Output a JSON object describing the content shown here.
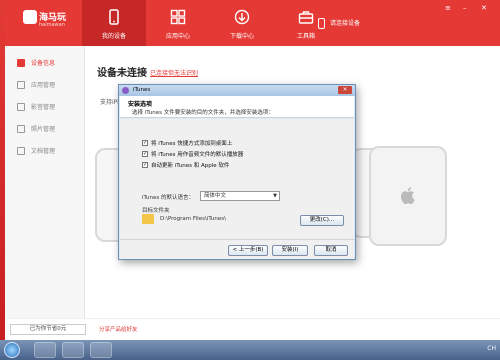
{
  "app": {
    "logo_name": "海马玩",
    "logo_sub": "haimawan",
    "nav": [
      {
        "label": "我的设备",
        "icon": "phone-icon",
        "active": true
      },
      {
        "label": "应用中心",
        "icon": "apps-grid-icon",
        "active": false
      },
      {
        "label": "下载中心",
        "icon": "download-icon",
        "active": false
      },
      {
        "label": "工具箱",
        "icon": "toolbox-icon",
        "active": false
      }
    ],
    "connect_label": "请连接设备"
  },
  "sidebar": {
    "items": [
      {
        "label": "设备信息",
        "icon": "device-info-icon",
        "active": true
      },
      {
        "label": "应用管理",
        "icon": "app-manage-icon",
        "active": false
      },
      {
        "label": "影音管理",
        "icon": "music-icon",
        "active": false
      },
      {
        "label": "照片管理",
        "icon": "photo-icon",
        "active": false
      },
      {
        "label": "文档管理",
        "icon": "document-icon",
        "active": false
      }
    ]
  },
  "main": {
    "title": "设备未连接",
    "link": "已连接但无法识别",
    "sub": "支持iPhon"
  },
  "status": {
    "storage": "已为你节省0元",
    "share": "分享产品给好友"
  },
  "dialog": {
    "window_title": "iTunes",
    "heading": "安装选项",
    "subheading": "选择 iTunes 文件要安装的目的文件夹，并选择安装选项：",
    "options": [
      {
        "label": "将 iTunes 快捷方式添加到桌面上",
        "checked": true
      },
      {
        "label": "将 iTunes 用作音频文件的默认播放器",
        "checked": true
      },
      {
        "label": "自动更新 iTunes 和 Apple 软件",
        "checked": true
      }
    ],
    "language_label": "iTunes 的默认语言：",
    "language_value": "简体中文",
    "folder_label": "目标文件夹",
    "folder_path": "D:\\Program Files\\iTunes\\",
    "change_button": "更改(C)...",
    "back_button": "< 上一步(B)",
    "install_button": "安装(I)",
    "cancel_button": "取消"
  },
  "taskbar": {
    "tray_text": "CH"
  },
  "colors": {
    "brand": "#e53935",
    "brand_dark": "#c62828"
  }
}
